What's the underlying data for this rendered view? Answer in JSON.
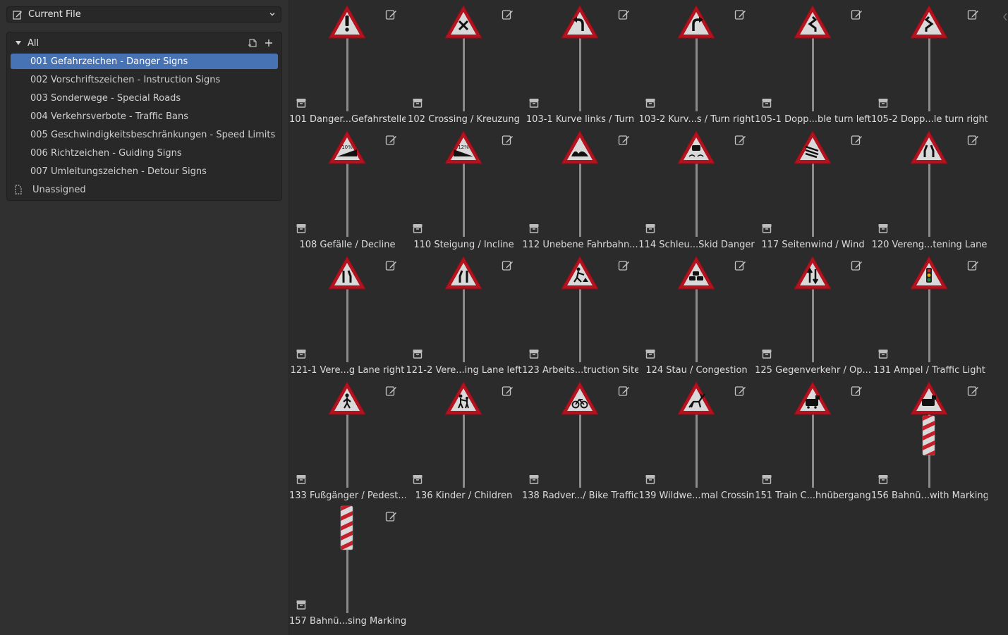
{
  "sidebar": {
    "library_select": {
      "label": "Current File",
      "icon": "library-edit-icon"
    },
    "catalog": {
      "root_label": "All",
      "items": [
        {
          "label": "001 Gefahrzeichen - Danger Signs",
          "selected": true
        },
        {
          "label": "002 Vorschriftszeichen - Instruction Signs",
          "selected": false
        },
        {
          "label": "003 Sonderwege - Special Roads",
          "selected": false
        },
        {
          "label": "004 Verkehrsverbote - Traffic Bans",
          "selected": false
        },
        {
          "label": "005 Geschwindigkeitsbeschränkungen - Speed Limits",
          "selected": false
        },
        {
          "label": "006 Richtzeichen - Guiding Signs",
          "selected": false
        },
        {
          "label": "007 Umleitungszeichen - Detour Signs",
          "selected": false
        }
      ],
      "unassigned_label": "Unassigned"
    }
  },
  "assets": [
    {
      "label": "101 Danger...Gefahrstelle",
      "symbol": "exclamation"
    },
    {
      "label": "102 Crossing / Kreuzung",
      "symbol": "cross"
    },
    {
      "label": "103-1 Kurve links / Turn",
      "symbol": "curve-left"
    },
    {
      "label": "103-2 Kurv...s / Turn right",
      "symbol": "curve-right"
    },
    {
      "label": "105-1 Dopp...ble turn left",
      "symbol": "double-left"
    },
    {
      "label": "105-2 Dopp...le turn right",
      "symbol": "double-right"
    },
    {
      "label": "108 Gefälle / Decline",
      "symbol": "decline"
    },
    {
      "label": "110 Steigung / Incline",
      "symbol": "incline"
    },
    {
      "label": "112 Unebene Fahrbahn...",
      "symbol": "uneven"
    },
    {
      "label": "114 Schleu...Skid Danger",
      "symbol": "skid"
    },
    {
      "label": "117 Seitenwind / Wind",
      "symbol": "wind"
    },
    {
      "label": "120 Vereng...tening Lane",
      "symbol": "narrow"
    },
    {
      "label": "121-1 Vere...g Lane right",
      "symbol": "narrow-right"
    },
    {
      "label": "121-2 Vere...ing Lane left",
      "symbol": "narrow-left"
    },
    {
      "label": "123 Arbeits...truction Site",
      "symbol": "works"
    },
    {
      "label": "124 Stau / Congestion",
      "symbol": "congestion"
    },
    {
      "label": "125 Gegenverkehr / Op...",
      "symbol": "two-way"
    },
    {
      "label": "131 Ampel / Traffic Light",
      "symbol": "traffic-light"
    },
    {
      "label": "133 Fußgänger / Pedest...",
      "symbol": "pedestrian"
    },
    {
      "label": "136 Kinder / Children",
      "symbol": "children"
    },
    {
      "label": "138 Radver.../ Bike Traffic",
      "symbol": "bike"
    },
    {
      "label": "139 Wildwe...mal Crossin",
      "symbol": "deer"
    },
    {
      "label": "151 Train C...hnübergang",
      "symbol": "train"
    },
    {
      "label": "156 Bahnü...with Marking",
      "symbol": "train-marker"
    },
    {
      "label": "157 Bahnü...sing Marking",
      "symbol": "marker-only"
    }
  ],
  "colors": {
    "selection": "#4772b3",
    "sign_border": "#b3121f",
    "sign_fill": "#d9d9d9"
  }
}
